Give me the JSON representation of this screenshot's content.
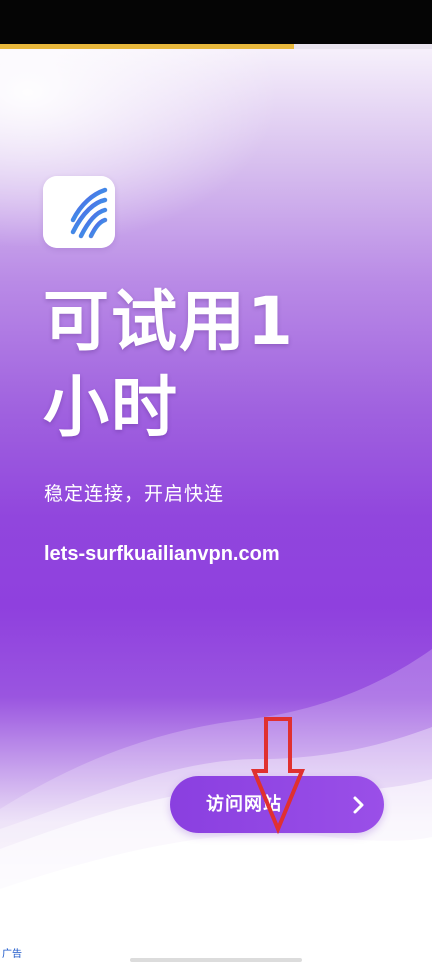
{
  "ad": {
    "headline_line1": "可试用1",
    "headline_line2": "小时",
    "subtitle": "稳定连接，开启快连",
    "url": "lets-surfkuailianvpn.com",
    "cta_label": "访问网站",
    "ad_label": "广告"
  },
  "icons": {
    "logo": "letsvpn-logo-icon",
    "cta_chevron": "chevron-right-icon",
    "annotation": "red-down-arrow-icon"
  },
  "progress": {
    "fraction": 0.68
  },
  "colors": {
    "status_bar": "#050505",
    "progress_fill": "#e8b83c",
    "brand_purple": "#8f40de",
    "cta": "#9147e4",
    "arrow": "#e03030",
    "ad_label": "#1a56c8"
  }
}
